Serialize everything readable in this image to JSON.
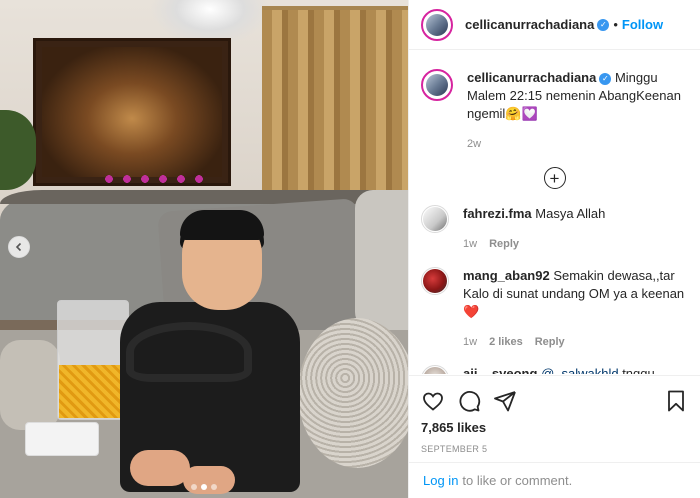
{
  "post": {
    "username": "cellicanurrachadiana",
    "follow_label": "Follow",
    "separator": "•",
    "caption": "Minggu Malem 22:15 nemenin AbangKeenan ngemil🤗💟",
    "caption_age": "2w",
    "likes": "7,865 likes",
    "date": "SEPTEMBER 5",
    "media_nav": {
      "prev_icon": "chevron-left-icon",
      "dots": 3,
      "active_dot": 2
    }
  },
  "comments": [
    {
      "user": "fahrezi.fma",
      "text": "Masya Allah",
      "age": "1w",
      "likes": "",
      "reply": "Reply"
    },
    {
      "user": "mang_aban92",
      "text": "Semakin dewasa,,tar Kalo di sunat undang OM ya a keenan❤️",
      "age": "1w",
      "likes": "2 likes",
      "reply": "Reply"
    },
    {
      "user": "aii__syeong",
      "mention": "@_salwakhld",
      "text": " tnggu keenan? Wht? Waaa tau crita yang aku kasih?"
    }
  ],
  "login_prompt": {
    "link": "Log in",
    "rest": "to like or comment."
  },
  "icons": [
    "heart-icon",
    "comment-icon",
    "share-icon",
    "bookmark-icon",
    "plus-circle-icon",
    "verified-icon"
  ],
  "colors": {
    "accent": "#0095f6",
    "verified": "#3897f0",
    "muted": "#8e8e8e",
    "text": "#262626"
  }
}
